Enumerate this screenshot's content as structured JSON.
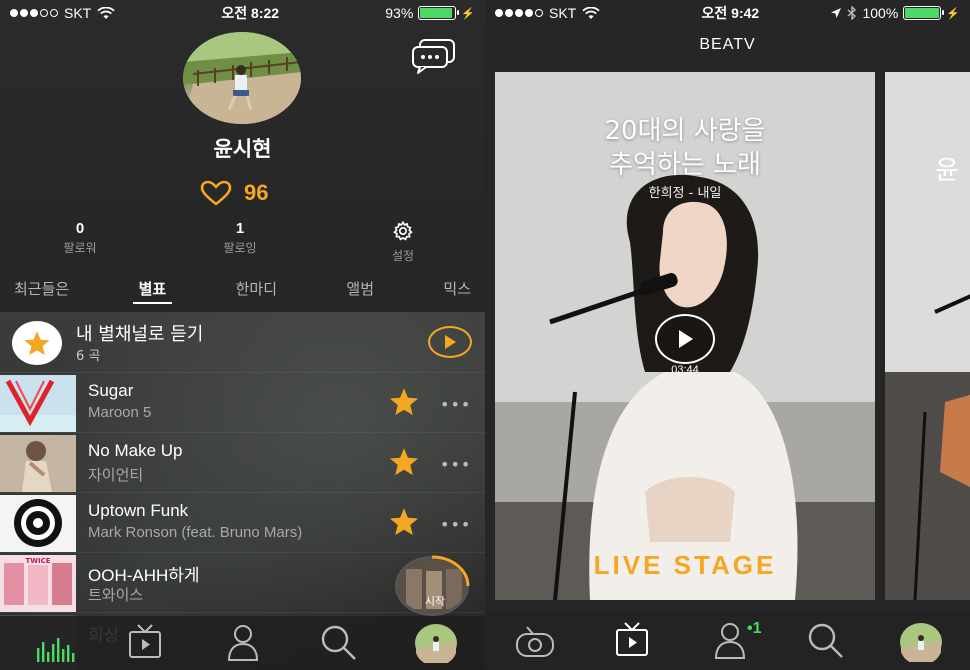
{
  "left_screen": {
    "status_bar": {
      "carrier": "SKT",
      "time": "오전 8:22",
      "battery_percent": "93%",
      "battery_level": 0.93,
      "signal_bars_filled": 3
    },
    "profile": {
      "name": "윤시현",
      "likes": "96",
      "followers": {
        "count": "0",
        "label": "팔로워"
      },
      "following": {
        "count": "1",
        "label": "팔로잉"
      },
      "settings_label": "설정"
    },
    "tabs": [
      {
        "label": "최근들은"
      },
      {
        "label": "별표",
        "active": true
      },
      {
        "label": "한마디"
      },
      {
        "label": "앨범"
      },
      {
        "label": "믹스"
      }
    ],
    "channel": {
      "title": "내 별채널로 듣기",
      "count": "6 곡"
    },
    "songs": [
      {
        "title": "Sugar",
        "artist": "Maroon 5"
      },
      {
        "title": "No Make Up",
        "artist": "자이언티"
      },
      {
        "title": "Uptown Funk",
        "artist": "Mark Ronson (feat. Bruno Mars)"
      },
      {
        "title": "OOH-AHH하게",
        "artist": "트와이스"
      },
      {
        "title": "회상",
        "artist": ""
      }
    ],
    "mini_player_art_text": "시작"
  },
  "right_screen": {
    "status_bar": {
      "carrier": "SKT",
      "time": "오전 9:42",
      "battery_percent": "100%",
      "battery_level": 1.0
    },
    "header_title": "BEATV",
    "card": {
      "title_line1": "20대의 사랑을",
      "title_line2": "추억하는 노래",
      "subtitle": "한희정 - 내일",
      "duration": "03:44",
      "brand": "LIVE STAGE"
    },
    "next_card_title": "윤",
    "nav_badge": "1"
  },
  "colors": {
    "accent_orange": "#f5a623",
    "battery_green": "#4cd964",
    "badge_green": "#4cd964"
  }
}
